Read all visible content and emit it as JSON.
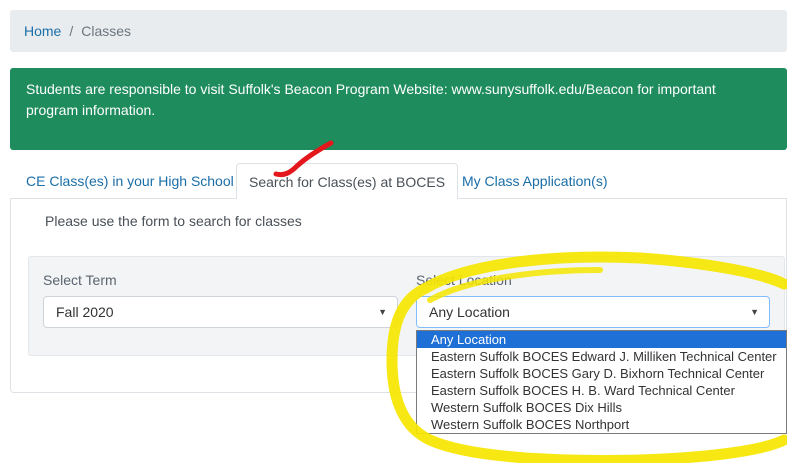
{
  "breadcrumb": {
    "home": "Home",
    "separator": "/",
    "current": "Classes"
  },
  "alert": {
    "text": "Students are responsible to visit Suffolk's Beacon Program Website: www.sunysuffolk.edu/Beacon for important program information."
  },
  "tabs": [
    {
      "label": "CE Class(es) in your High School"
    },
    {
      "label": "Search for Class(es) at BOCES"
    },
    {
      "label": "My Class Application(s)"
    }
  ],
  "form": {
    "hint": "Please use the form to search for classes",
    "term": {
      "label": "Select Term",
      "value": "Fall 2020"
    },
    "location": {
      "label": "Select Location",
      "value": "Any Location",
      "options": [
        "Any Location",
        "Eastern Suffolk BOCES Edward J. Milliken Technical Center",
        "Eastern Suffolk BOCES Gary D. Bixhorn Technical Center",
        "Eastern Suffolk BOCES H. B. Ward Technical Center",
        "Western Suffolk BOCES Dix Hills",
        "Western Suffolk BOCES Northport"
      ]
    }
  },
  "colors": {
    "alert_bg": "#1e8c5c",
    "link": "#1a6ea8",
    "highlight_option": "#1e70d6",
    "annotation_circle": "#f6e600",
    "annotation_mark": "#e3171c"
  }
}
